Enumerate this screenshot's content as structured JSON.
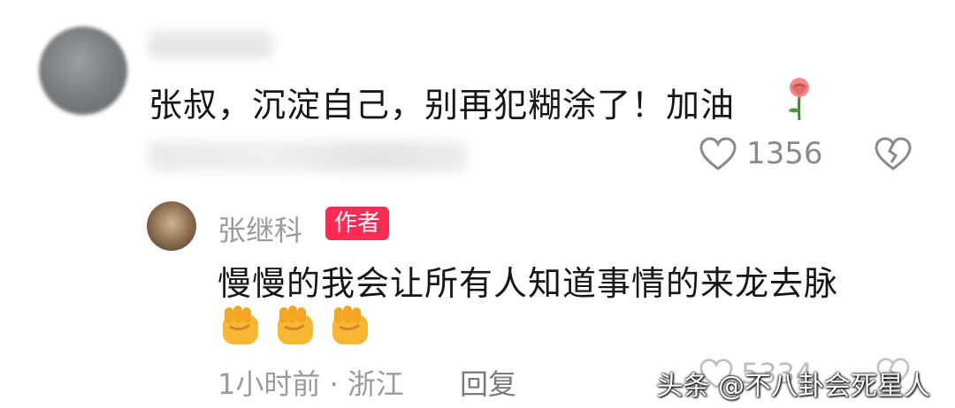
{
  "top_comment": {
    "text": "张叔，沉淀自己，别再犯糊涂了！加油",
    "emoji_icon": "rose-icon",
    "like_count": "1356"
  },
  "reply": {
    "author_name": "张继科",
    "author_badge": "作者",
    "text": "慢慢的我会让所有人知道事情的来龙去脉",
    "emoji_icons": [
      "fist-icon",
      "fist-icon",
      "fist-icon"
    ],
    "meta": "1小时前 · 浙江",
    "reply_label": "回复",
    "like_count": "5334"
  },
  "watermark": "头条 @不八卦会死星人",
  "colors": {
    "badge": "#fe2c55",
    "text_primary": "#161616",
    "text_secondary": "#9a9a9a"
  }
}
